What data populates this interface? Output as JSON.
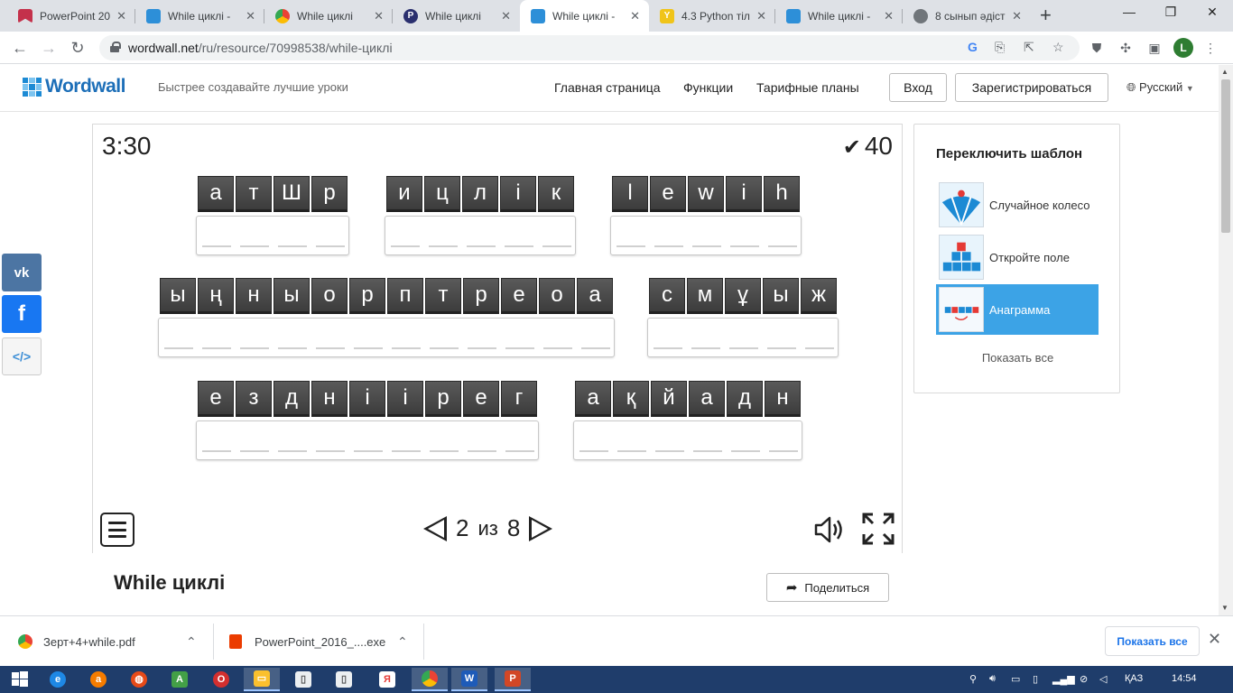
{
  "browser": {
    "tabs": [
      {
        "title": "PowerPoint 20",
        "icon": "powerpoint-bookmark-icon",
        "active": false
      },
      {
        "title": "While циклі - ",
        "icon": "wordwall-icon",
        "active": false
      },
      {
        "title": "While циклі",
        "icon": "chrome-icon",
        "active": false
      },
      {
        "title": "While циклі",
        "icon": "p-icon",
        "active": false
      },
      {
        "title": "While циклі - ",
        "icon": "wordwall-icon",
        "active": true
      },
      {
        "title": "4.3 Python тіл",
        "icon": "y-icon",
        "active": false
      },
      {
        "title": "While циклі - ",
        "icon": "wordwall-icon",
        "active": false
      },
      {
        "title": "8 сынып әдіст",
        "icon": "globe-icon",
        "active": false
      }
    ],
    "url_host": "wordwall.net",
    "url_path": "/ru/resource/70998538/while-циклі",
    "profile_initial": "L"
  },
  "site": {
    "logo_text": "Wordwall",
    "tagline": "Быстрее создавайте лучшие уроки",
    "nav": [
      "Главная страница",
      "Функции",
      "Тарифные планы"
    ],
    "login_label": "Вход",
    "register_label": "Зарегистрироваться",
    "language": "Русский"
  },
  "game": {
    "timer": "3:30",
    "score": "40",
    "words": [
      {
        "letters": [
          "а",
          "т",
          "Ш",
          "р"
        ],
        "slots": 4
      },
      {
        "letters": [
          "и",
          "ц",
          "л",
          "і",
          "к"
        ],
        "slots": 5
      },
      {
        "letters": [
          "l",
          "e",
          "w",
          "i",
          "h"
        ],
        "slots": 5
      },
      {
        "letters": [
          "ы",
          "ң",
          "н",
          "ы",
          "о",
          "р",
          "п",
          "т",
          "р",
          "е",
          "о",
          "а"
        ],
        "slots": 12
      },
      {
        "letters": [
          "с",
          "м",
          "ұ",
          "ы",
          "ж"
        ],
        "slots": 5
      },
      {
        "letters": [
          "е",
          "з",
          "д",
          "н",
          "і",
          "і",
          "р",
          "е",
          "г"
        ],
        "slots": 9
      },
      {
        "letters": [
          "а",
          "қ",
          "й",
          "а",
          "д",
          "н"
        ],
        "slots": 6
      }
    ],
    "page_current": "2",
    "page_sep": "из",
    "page_total": "8"
  },
  "activity": {
    "title": "While циклі",
    "share_label": "Поделиться"
  },
  "templates": {
    "title": "Переключить шаблон",
    "items": [
      {
        "label": "Случайное колесо",
        "selected": false
      },
      {
        "label": "Откройте поле",
        "selected": false
      },
      {
        "label": "Анаграмма",
        "selected": true
      }
    ],
    "show_all": "Показать все"
  },
  "social": {
    "vk": "vk",
    "fb": "f",
    "embed": "</>"
  },
  "downloads": {
    "items": [
      {
        "name": "Зерт+4+while.pdf",
        "icon": "chrome-icon"
      },
      {
        "name": "PowerPoint_2016_....exe",
        "icon": "office-icon"
      }
    ],
    "show_all": "Показать все"
  },
  "taskbar": {
    "apps": [
      "windows-start",
      "ie-icon",
      "avast-icon",
      "app-green-icon",
      "opera-icon",
      "explorer-icon",
      "file-icon",
      "yandex-icon",
      "chrome-icon",
      "word-icon",
      "powerpoint-icon"
    ],
    "lang": "ҚАЗ",
    "time": "14:54"
  },
  "colors": {
    "tile": "#4a4a4a",
    "selected_template": "#3ca3e6",
    "taskbar": "#1f3d6b",
    "brand": "#1d6fb8"
  }
}
